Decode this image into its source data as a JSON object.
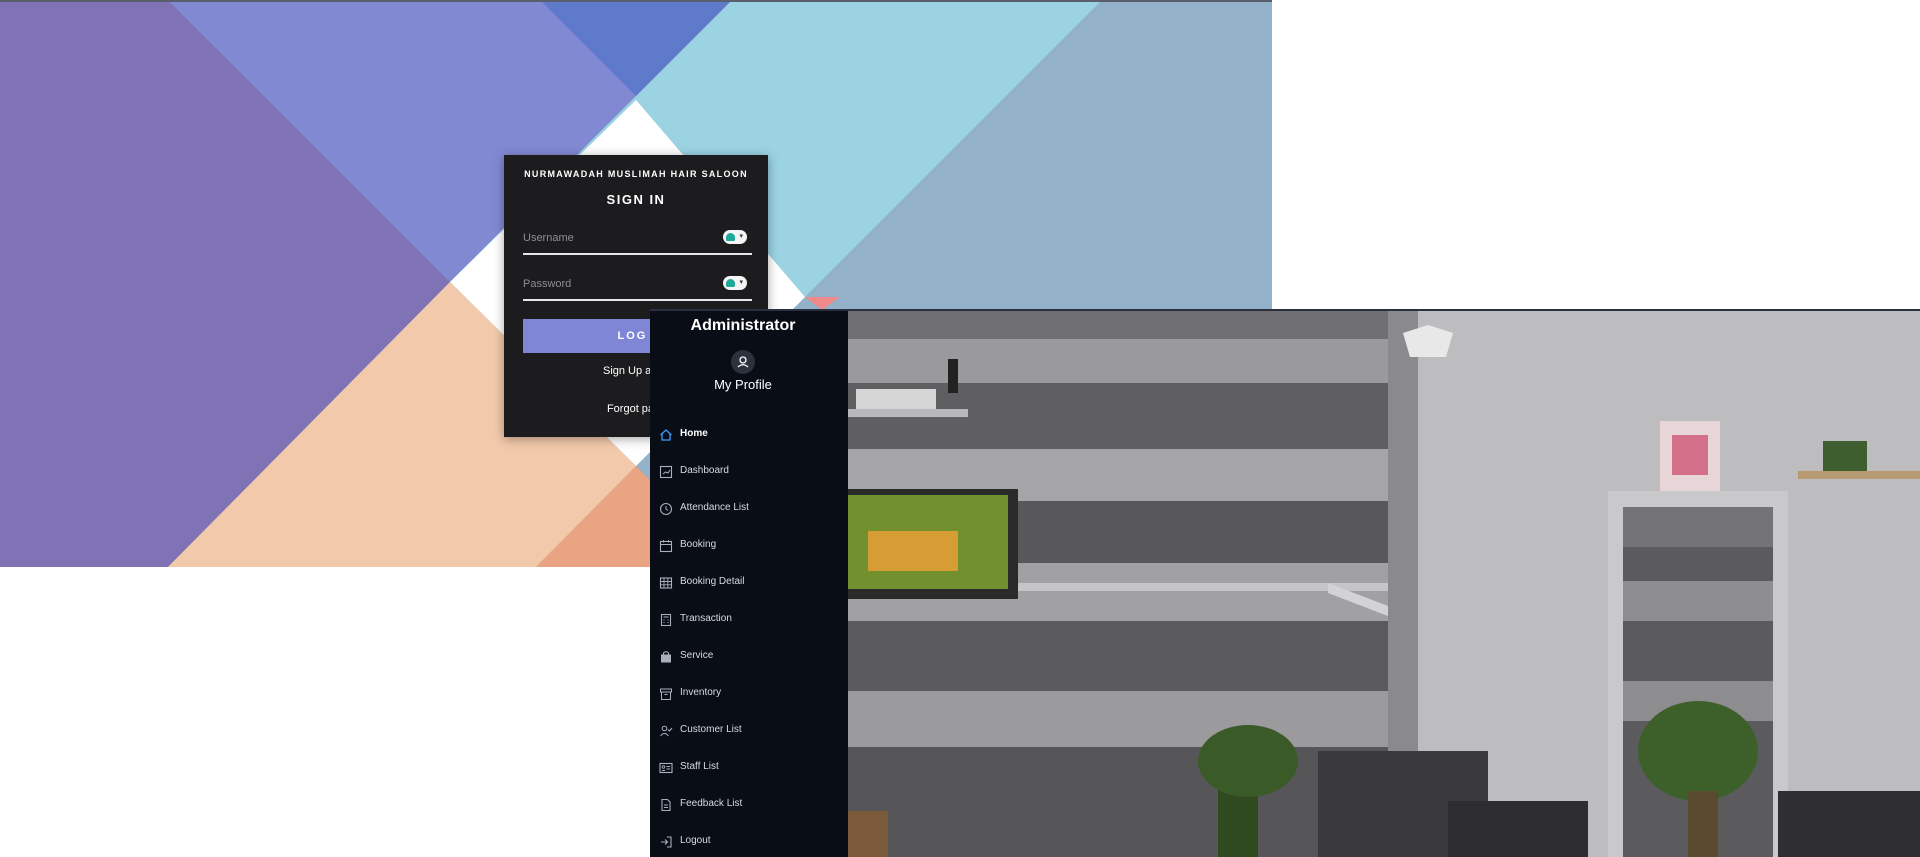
{
  "login": {
    "brand": "NURMAWADAH MUSLIMAH HAIR SALOON",
    "title": "SIGN IN",
    "username_placeholder": "Username",
    "password_placeholder": "Password",
    "login_button": "LOG I",
    "signup_link": "Sign Up as M",
    "forgot_link": "Forgot pass"
  },
  "admin": {
    "title": "Administrator",
    "profile_link": "My Profile",
    "nav": [
      {
        "label": "Home",
        "icon": "home-icon",
        "active": true
      },
      {
        "label": "Dashboard",
        "icon": "chart-icon"
      },
      {
        "label": "Attendance List",
        "icon": "clock-icon"
      },
      {
        "label": "Booking",
        "icon": "calendar-icon"
      },
      {
        "label": "Booking Detail",
        "icon": "table-icon"
      },
      {
        "label": "Transaction",
        "icon": "calculator-icon"
      },
      {
        "label": "Service",
        "icon": "bag-icon"
      },
      {
        "label": "Inventory",
        "icon": "archive-icon"
      },
      {
        "label": "Customer List",
        "icon": "users-icon"
      },
      {
        "label": "Staff List",
        "icon": "id-card-icon"
      },
      {
        "label": "Feedback List",
        "icon": "document-icon"
      },
      {
        "label": "Logout",
        "icon": "logout-icon"
      }
    ]
  },
  "colors": {
    "accent_button": "#7f86d6",
    "card_bg": "#1c1c1e",
    "sidebar_bg": "#080d16",
    "active_icon": "#3b9cff"
  }
}
